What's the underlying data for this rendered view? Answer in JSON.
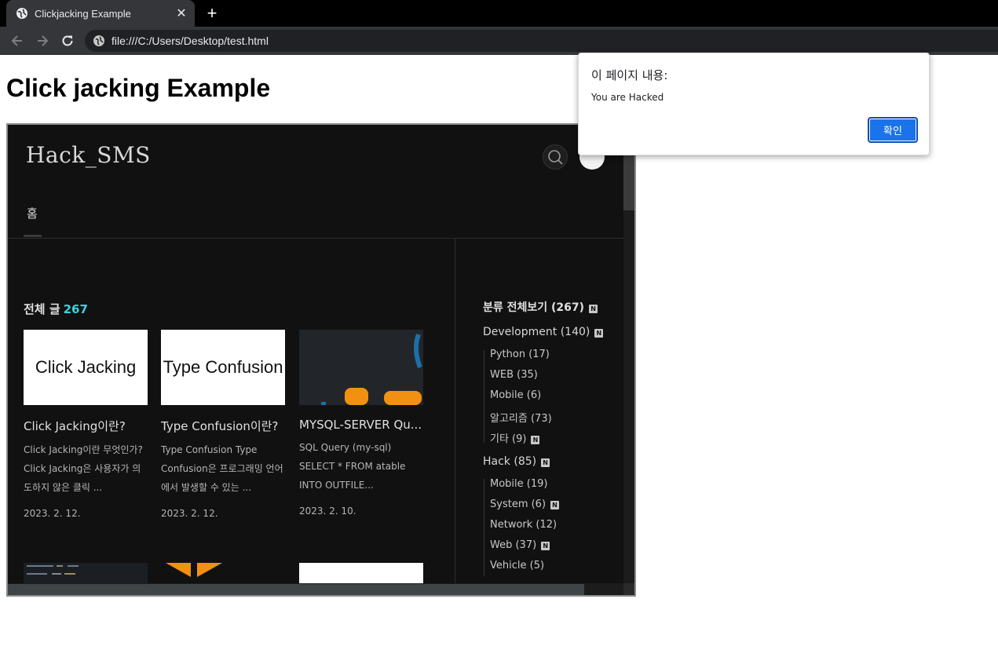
{
  "browser": {
    "tab_title": "Clickjacking Example",
    "close_glyph": "✕",
    "new_tab_glyph": "+",
    "url": "file:///C:/Users/Desktop/test.html"
  },
  "page": {
    "heading": "Click jacking Example"
  },
  "blog": {
    "logo": "Hack_SMS",
    "nav_home": "홈",
    "section_title": "전체 글",
    "section_count": "267",
    "posts": [
      {
        "thumb_text": "Click Jacking",
        "title": "Click Jacking이란?",
        "summary": "Click Jacking이란 무엇인가? Click Jacking은 사용자가 의도하지 않은 클릭 ...",
        "date": "2023. 2. 12."
      },
      {
        "thumb_text": "Type Confusion",
        "title": "Type Confusion이란?",
        "summary": "Type Confusion Type Confusion은 프로그래밍 언어에서 발생할 수 있는 ...",
        "date": "2023. 2. 12."
      },
      {
        "thumb_text": "",
        "title": "MYSQL-SERVER Qu...",
        "summary": "SQL Query (my-sql) SELECT * FROM atable INTO OUTFILE...",
        "date": "2023. 2. 10."
      }
    ],
    "categories": [
      {
        "label": "분류 전체보기 (267)",
        "new": true,
        "level": "all"
      },
      {
        "label": "Development (140)",
        "new": true,
        "level": "top"
      },
      {
        "label": "Python (17)",
        "new": false,
        "level": "sub"
      },
      {
        "label": "WEB (35)",
        "new": false,
        "level": "sub"
      },
      {
        "label": "Mobile (6)",
        "new": false,
        "level": "sub"
      },
      {
        "label": "알고리즘 (73)",
        "new": false,
        "level": "sub"
      },
      {
        "label": "기타 (9)",
        "new": true,
        "level": "sub"
      },
      {
        "label": "Hack (85)",
        "new": true,
        "level": "top"
      },
      {
        "label": "Mobile (19)",
        "new": false,
        "level": "sub"
      },
      {
        "label": "System (6)",
        "new": true,
        "level": "sub"
      },
      {
        "label": "Network (12)",
        "new": false,
        "level": "sub"
      },
      {
        "label": "Web (37)",
        "new": true,
        "level": "sub"
      },
      {
        "label": "Vehicle (5)",
        "new": false,
        "level": "sub"
      }
    ],
    "new_badge": "N"
  },
  "dialog": {
    "heading": "이 페이지 내용:",
    "message": "You are Hacked",
    "ok_label": "확인"
  },
  "colors": {
    "accent_count": "#3fd0e0",
    "dialog_button": "#1a73e8"
  }
}
